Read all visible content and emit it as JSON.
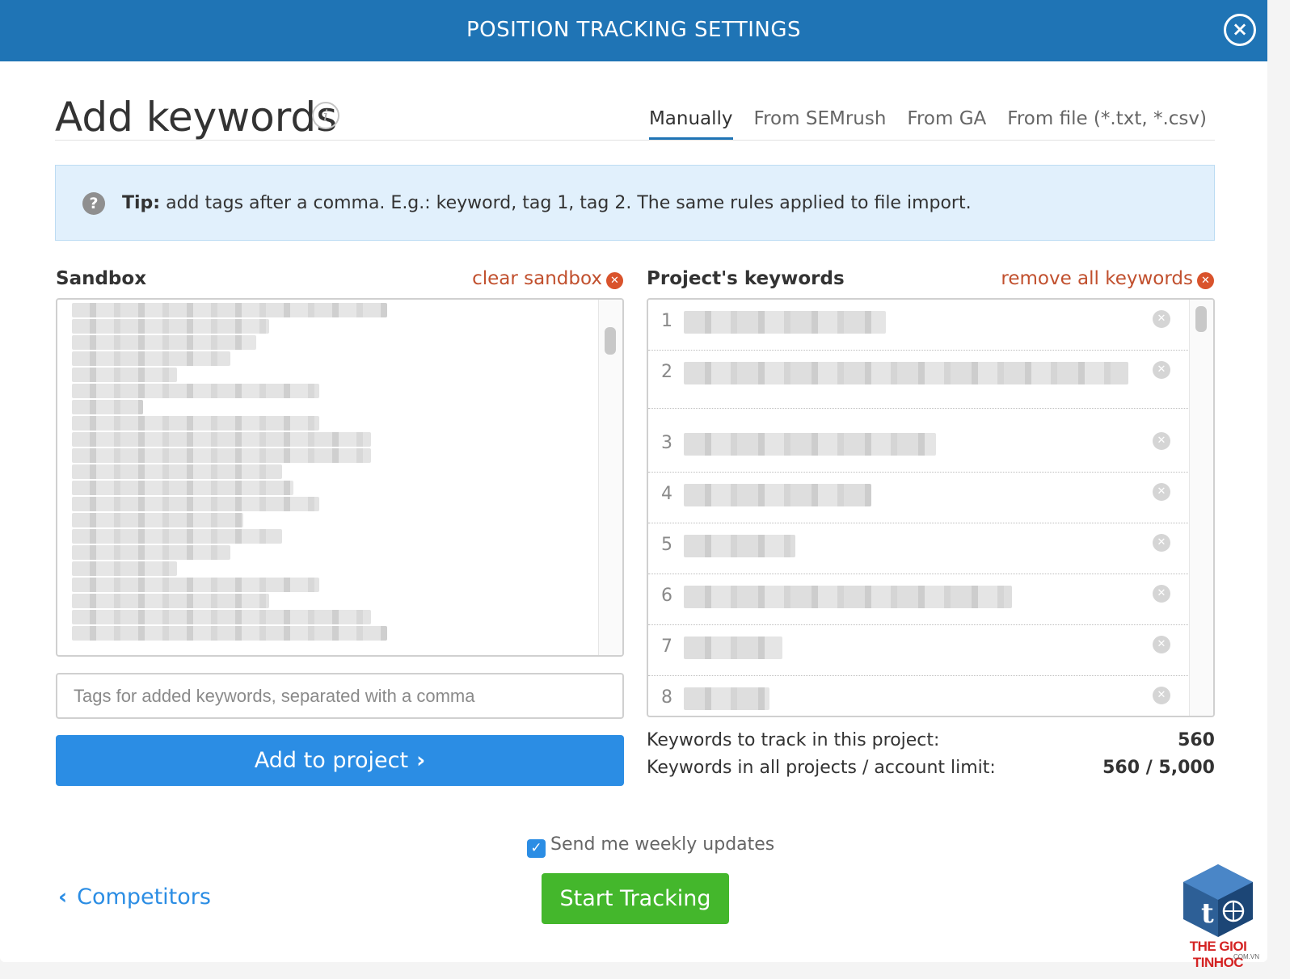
{
  "header": {
    "title": "POSITION TRACKING SETTINGS",
    "close_icon": "close-icon"
  },
  "section": {
    "title": "Add keywords",
    "info_icon": "info-icon"
  },
  "tabs": [
    {
      "label": "Manually",
      "active": true
    },
    {
      "label": "From SEMrush",
      "active": false
    },
    {
      "label": "From GA",
      "active": false
    },
    {
      "label": "From file (*.txt, *.csv)",
      "active": false
    }
  ],
  "tip": {
    "label": "Tip:",
    "text": " add tags after a comma. E.g.: keyword, tag 1, tag 2. The same rules applied to file import."
  },
  "sandbox": {
    "label": "Sandbox",
    "clear_label": "clear sandbox"
  },
  "tags_input": {
    "placeholder": "Tags for added keywords, separated with a comma",
    "value": ""
  },
  "add_button": {
    "label": "Add to project",
    "chevron": "›"
  },
  "project_keywords": {
    "label": "Project's keywords",
    "remove_all_label": "remove all keywords",
    "rows": [
      {
        "num": "1"
      },
      {
        "num": "2"
      },
      {
        "num": "3"
      },
      {
        "num": "4"
      },
      {
        "num": "5"
      },
      {
        "num": "6"
      },
      {
        "num": "7"
      },
      {
        "num": "8"
      }
    ]
  },
  "stats": {
    "track_label": "Keywords to track in this project:",
    "track_value": "560",
    "limit_label": "Keywords in all projects / account limit:",
    "limit_value": "560 / 5,000"
  },
  "weekly_updates": {
    "label": "Send me weekly updates",
    "checked": true
  },
  "back_link": {
    "label": "Competitors"
  },
  "start_button": {
    "label": "Start Tracking"
  },
  "watermark": {
    "text": "THE GIOI TINHOC",
    "sub": ".COM.VN"
  },
  "colors": {
    "header": "#1f74b5",
    "primary": "#2b8de4",
    "success": "#44b72c",
    "danger_link": "#c1502e",
    "tip_bg": "#e1f0fc"
  }
}
